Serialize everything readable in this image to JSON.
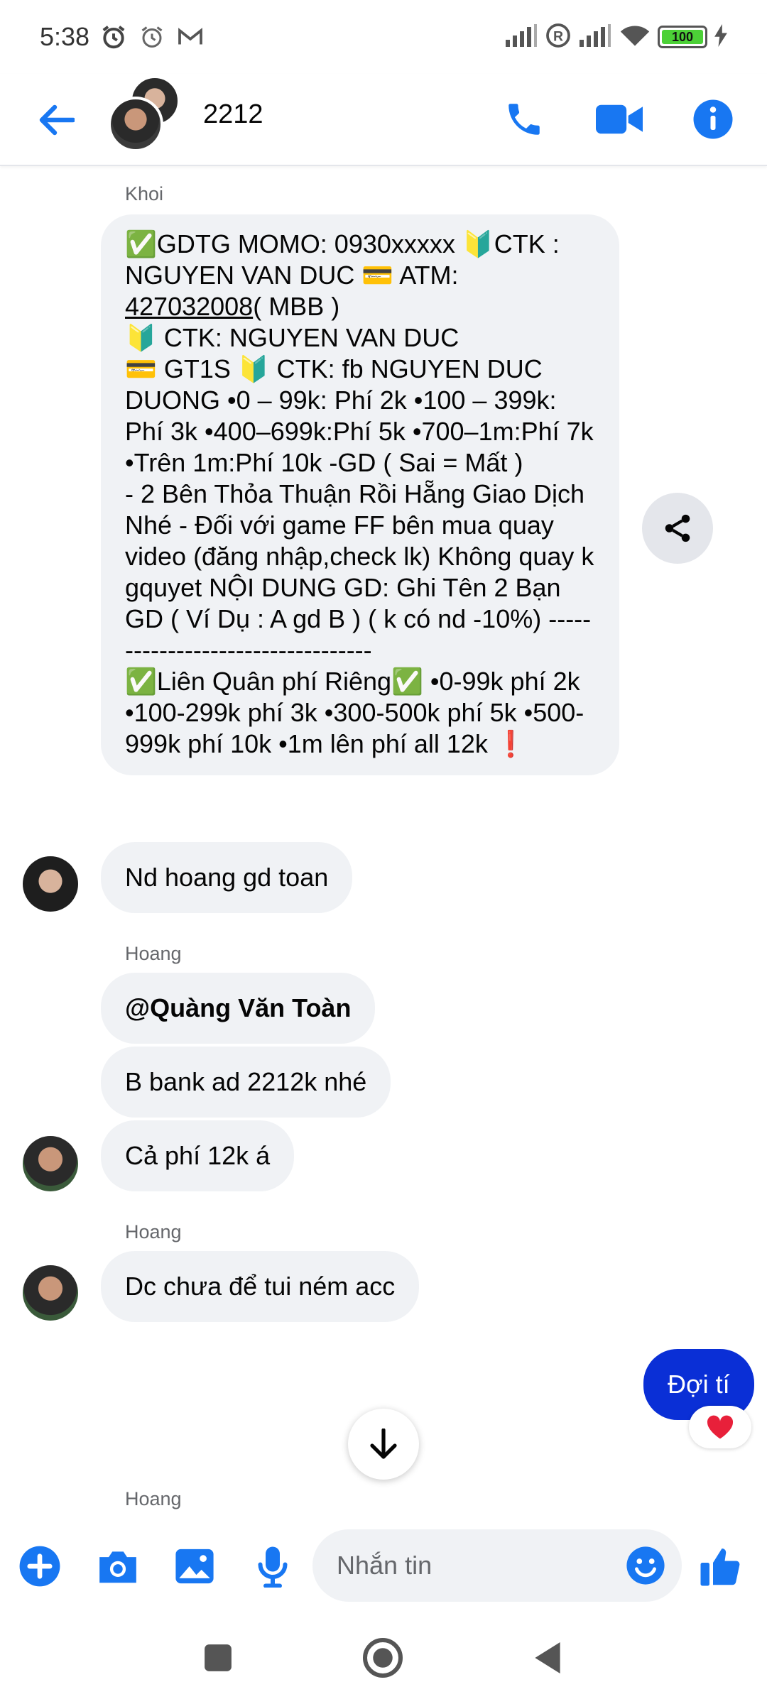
{
  "status_bar": {
    "time": "5:38",
    "battery": "100",
    "battery_level": 1.0
  },
  "header": {
    "title": "2212",
    "icons": [
      "back-arrow-icon",
      "phone-icon",
      "video-camera-icon",
      "info-icon"
    ]
  },
  "messages": {
    "khoi_sender": "Khoi",
    "khoi_pre": "✅GDTG  MOMO: 0930xxxxx 🔰CTK : NGUYEN VAN DUC 💳 ATM: ",
    "khoi_account": "427032008",
    "khoi_post": "( MBB )\n🔰 CTK: NGUYEN VAN DUC\n💳 GT1S 🔰 CTK: fb NGUYEN DUC DUONG                    •0 – 99k: Phí 2k •100 – 399k: Phí 3k •400–699k:Phí 5k •700–1m:Phí 7k •Trên 1m:Phí 10k -GD ( Sai = Mất )\n- 2 Bên Thỏa Thuận Rồi Hẵng Giao Dịch Nhé  - Đối với game FF bên mua quay video (đăng nhập,check lk) Không quay k gquyet  NỘI DUNG GD: Ghi Tên 2 Bạn GD                              ( Ví Dụ : A gd B ) ( k có nd -10%)    ----------------------------------\n✅Liên Quân phí Riêng✅ •0-99k phí 2k •100-299k phí 3k •300-500k phí 5k •500-999k phí 10k •1m lên phí all 12k ❗",
    "nd_hoang": "Nd hoang gd toan",
    "hoang_sender_1": "Hoang",
    "mention": "@Quàng Văn Toàn",
    "bank_msg": "B bank ad 2212k nhé",
    "fee_msg": "Cả phí 12k á",
    "hoang_sender_2": "Hoang",
    "dc_msg": "Dc chưa để tui ném acc",
    "my_msg": "Đợi tí",
    "reaction": "❤️",
    "hoang_sender_3": "Hoang"
  },
  "composer": {
    "placeholder": "Nhắn tin",
    "icons": [
      "plus-icon",
      "camera-icon",
      "gallery-icon",
      "microphone-icon",
      "emoji-icon",
      "thumbs-up-icon"
    ]
  },
  "colors": {
    "accent": "#1877f2",
    "my_bubble": "#0a2fd6",
    "other_bubble": "#f0f2f5"
  }
}
